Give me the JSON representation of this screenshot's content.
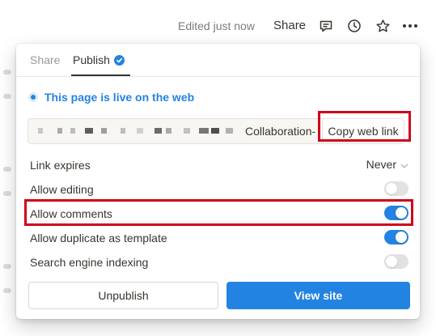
{
  "topbar": {
    "edited_label": "Edited just now",
    "share_label": "Share",
    "icons": [
      "comment-icon",
      "history-clock-icon",
      "star-icon",
      "more-dots-icon"
    ]
  },
  "popover": {
    "tabs": [
      {
        "label": "Share",
        "active": false
      },
      {
        "label": "Publish",
        "active": true
      }
    ],
    "live_status": "This page is live on the web",
    "url": {
      "visible_suffix": "Collaboration-",
      "redacted": true
    },
    "copy_button": "Copy web link",
    "settings": [
      {
        "label": "Link expires",
        "type": "select",
        "value": "Never"
      },
      {
        "label": "Allow editing",
        "type": "toggle",
        "on": false
      },
      {
        "label": "Allow comments",
        "type": "toggle",
        "on": true
      },
      {
        "label": "Allow duplicate as template",
        "type": "toggle",
        "on": true
      },
      {
        "label": "Search engine indexing",
        "type": "toggle",
        "on": false
      }
    ],
    "unpublish_button": "Unpublish",
    "view_site_button": "View site"
  },
  "colors": {
    "accent": "#2383e2",
    "text": "#37352f",
    "muted": "#9b9a97",
    "highlight": "#d0021b"
  }
}
